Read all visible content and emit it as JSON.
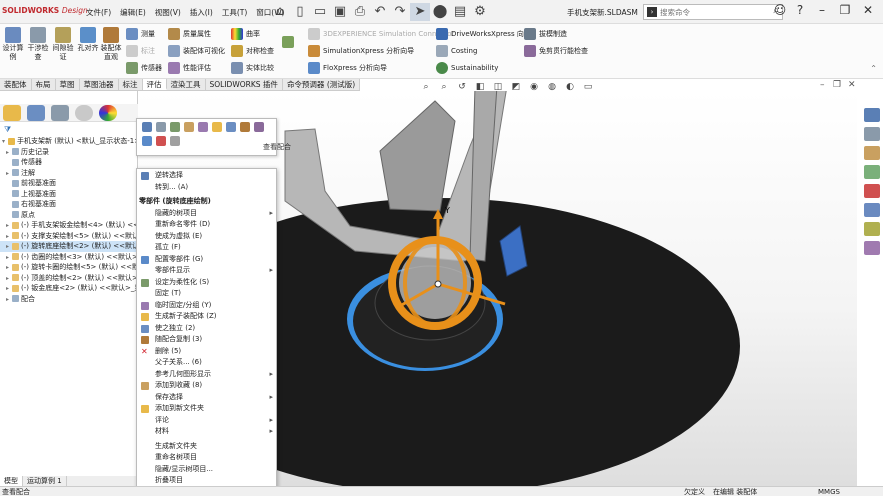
{
  "app": {
    "brand": "SOLIDWORKS",
    "edition": "Design",
    "doc_title": "手机支架新.SLDASM"
  },
  "menu": [
    "文件(F)",
    "编辑(E)",
    "视图(V)",
    "插入(I)",
    "工具(T)",
    "窗口(W)"
  ],
  "search": {
    "placeholder": "搜索命令"
  },
  "ribbon": {
    "big": [
      "设计算例",
      "干涉检查",
      "间隙验证",
      "孔对齐",
      "装配体直观"
    ],
    "col1": [
      "测量",
      "标注",
      "传感器"
    ],
    "col2": [
      "质量属性",
      "装配体可视化",
      "性能评估"
    ],
    "col3": [
      "曲率",
      "对称检查",
      "实体比较"
    ],
    "col4": [
      "3DEXPERIENCE Simulation Connector",
      "SimulationXpress 分析向导",
      "FloXpress 分析向导"
    ],
    "col5": [
      "DriveWorksXpress 向导",
      "Costing",
      "Sustainability"
    ],
    "col6": [
      "拔模制造",
      "免剪贯行能检查"
    ]
  },
  "tabs": [
    "装配体",
    "布局",
    "草图",
    "草图油器",
    "标注",
    "评估",
    "渲染工具",
    "SOLIDWORKS 插件",
    "命令预调器 (测试版)"
  ],
  "active_tab": "评估",
  "tree": [
    {
      "label": "手机支架新 (默认) <默认_显示状态-1>",
      "indent": 0,
      "arrow": "▾"
    },
    {
      "label": "历史记录",
      "indent": 1,
      "arrow": "▸"
    },
    {
      "label": "传感器",
      "indent": 1,
      "arrow": ""
    },
    {
      "label": "注解",
      "indent": 1,
      "arrow": "▸"
    },
    {
      "label": "前视基准面",
      "indent": 1,
      "arrow": ""
    },
    {
      "label": "上视基准面",
      "indent": 1,
      "arrow": ""
    },
    {
      "label": "右视基准面",
      "indent": 1,
      "arrow": ""
    },
    {
      "label": "原点",
      "indent": 1,
      "arrow": ""
    },
    {
      "label": "(-) 手机支架钣金绘制<4> (默认) <<",
      "indent": 1,
      "arrow": "▸"
    },
    {
      "label": "(-) 支撑支架绘制<5> (默认) <<默认",
      "indent": 1,
      "arrow": "▸"
    },
    {
      "label": "(-) 旋转底座绘制<2> (默认) <<默认",
      "indent": 1,
      "arrow": "▸",
      "selected": true
    },
    {
      "label": "(-) 齿圈的绘制<3> (默认) <<默认>_",
      "indent": 1,
      "arrow": "▸"
    },
    {
      "label": "(-) 旋转卡圈的绘制<5> (默认) <<默",
      "indent": 1,
      "arrow": "▸"
    },
    {
      "label": "(-) 顶盖的绘制<2> (默认) <<默认>_",
      "indent": 1,
      "arrow": "▸"
    },
    {
      "label": "(-) 钣金底座<2> (默认) <<默认>_显",
      "indent": 1,
      "arrow": "▸"
    },
    {
      "label": "配合",
      "indent": 1,
      "arrow": "▸"
    }
  ],
  "bottom_tabs": [
    "模型",
    "运动算例 1"
  ],
  "tooltip": "查看配合",
  "context_menu": [
    {
      "label": "逆转选择",
      "icon": true
    },
    {
      "label": "转到... (A)"
    },
    {
      "label": "零部件 (旋转底座绘制)",
      "header": true
    },
    {
      "label": "隐藏的树项目",
      "sub": true
    },
    {
      "label": "重新命名零件 (D)"
    },
    {
      "label": "使成为虚拟 (E)"
    },
    {
      "label": "孤立 (F)"
    },
    {
      "label": "配置零部件 (G)",
      "icon": true
    },
    {
      "label": "零部件显示",
      "sub": true
    },
    {
      "label": "设定为柔性化 (S)",
      "icon": true
    },
    {
      "label": "固定 (T)"
    },
    {
      "label": "临时固定/分组 (Y)",
      "icon": true
    },
    {
      "label": "生成新子装配体 (Z)",
      "icon": true
    },
    {
      "label": "使之独立 (2)",
      "icon": true
    },
    {
      "label": "随配合复制 (3)",
      "icon": true
    },
    {
      "label": "删除 (5)",
      "delete": true
    },
    {
      "label": "父子关系... (6)"
    },
    {
      "label": "参考几何图形显示",
      "sub": true
    },
    {
      "label": "添加到收藏 (8)",
      "icon": true
    },
    {
      "label": "保存选择",
      "sub": true
    },
    {
      "label": "添加到新文件夹",
      "icon": true
    },
    {
      "label": "评论",
      "sub": true
    },
    {
      "label": "材料",
      "sub": true
    },
    {
      "label": "生成新文件夹"
    },
    {
      "label": "重命名树项目"
    },
    {
      "label": "隐藏/显示树项目..."
    },
    {
      "label": "折叠项目"
    }
  ],
  "axis_y": "Y",
  "status": {
    "left": "查看配合",
    "state1": "欠定义",
    "state2": "在编辑 装配体",
    "units": "MMGS"
  }
}
